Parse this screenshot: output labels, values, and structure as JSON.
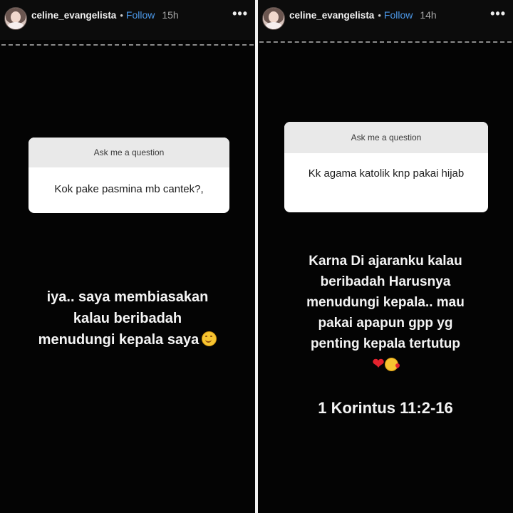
{
  "stories": [
    {
      "username": "celine_evangelista",
      "separator": "•",
      "follow_label": "Follow",
      "time": "15h",
      "more_label": "•••",
      "question_card": {
        "header": "Ask me a question",
        "question": "Kok pake pasmina mb cantek?,"
      },
      "answer_lines": [
        "iya.. saya membiasakan",
        "kalau beribadah",
        "menudungi kepala saya"
      ],
      "answer_emoji": "smiling-face-icon"
    },
    {
      "username": "celine_evangelista",
      "separator": "•",
      "follow_label": "Follow",
      "time": "14h",
      "more_label": "•••",
      "question_card": {
        "header": "Ask me a question",
        "question": "Kk agama katolik knp pakai hijab"
      },
      "answer_lines": [
        "Karna Di ajaranku kalau",
        "beribadah Harusnya",
        "menudungi kepala.. mau",
        "pakai apapun gpp yg",
        "penting kepala tertutup"
      ],
      "answer_emojis": [
        "red-heart-icon",
        "face-blowing-kiss-icon"
      ],
      "verse": "1 Korintus 11:2-16"
    }
  ],
  "colors": {
    "background": "#040404",
    "follow": "#4c98e8",
    "card_header": "#e9e9e9",
    "text_light": "#f4f4f4"
  }
}
